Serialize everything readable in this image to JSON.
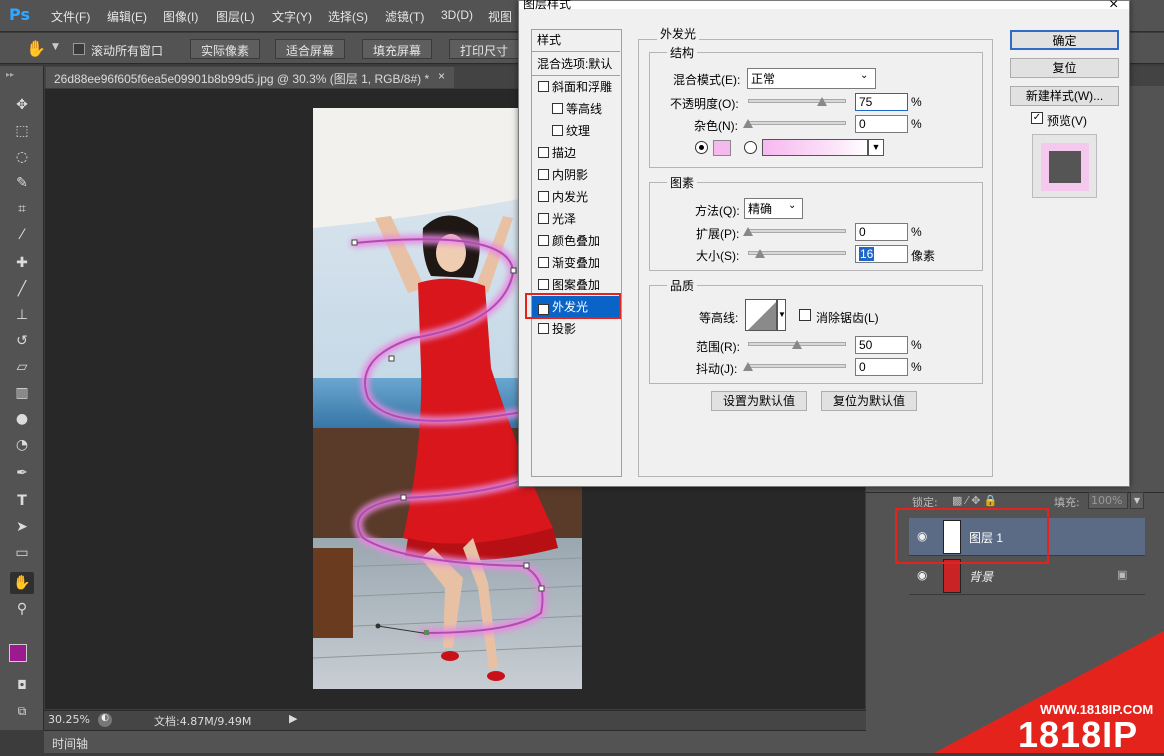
{
  "app": {
    "logo": "Ps",
    "menu": [
      "文件(F)",
      "编辑(E)",
      "图像(I)",
      "图层(L)",
      "文字(Y)",
      "选择(S)",
      "滤镜(T)",
      "3D(D)",
      "视图"
    ]
  },
  "options_bar": {
    "scroll_all_label": "滚动所有窗口",
    "buttons": [
      "实际像素",
      "适合屏幕",
      "填充屏幕",
      "打印尺寸"
    ]
  },
  "document": {
    "tab_title": "26d88ee96f605f6ea5e09901b8b99d5.jpg @ 30.3% (图层 1, RGB/8#) *",
    "close_glyph": "×"
  },
  "status": {
    "zoom": "30.25%",
    "doc_size": "文档:4.87M/9.49M",
    "timeline": "时间轴"
  },
  "layers": {
    "lock_label": "锁定:",
    "fill_label": "填充:",
    "fill_value": "100%",
    "items": [
      {
        "name": "图层 1",
        "selected": true
      },
      {
        "name": "背景",
        "selected": false
      }
    ]
  },
  "dialog": {
    "title": "图层样式",
    "close_glyph": "×",
    "styles_header": "样式",
    "blend_options": "混合选项:默认",
    "style_items": [
      {
        "label": "斜面和浮雕",
        "checked": false,
        "indent": false
      },
      {
        "label": "等高线",
        "checked": false,
        "indent": true
      },
      {
        "label": "纹理",
        "checked": false,
        "indent": true
      },
      {
        "label": "描边",
        "checked": false,
        "indent": false
      },
      {
        "label": "内阴影",
        "checked": false,
        "indent": false
      },
      {
        "label": "内发光",
        "checked": false,
        "indent": false
      },
      {
        "label": "光泽",
        "checked": false,
        "indent": false
      },
      {
        "label": "颜色叠加",
        "checked": false,
        "indent": false
      },
      {
        "label": "渐变叠加",
        "checked": false,
        "indent": false
      },
      {
        "label": "图案叠加",
        "checked": false,
        "indent": false
      },
      {
        "label": "外发光",
        "checked": true,
        "indent": false,
        "selected": true
      },
      {
        "label": "投影",
        "checked": false,
        "indent": false
      }
    ],
    "panel_title": "外发光",
    "structure": {
      "title": "结构",
      "blend_mode_label": "混合模式(E):",
      "blend_mode_value": "正常",
      "opacity_label": "不透明度(O):",
      "opacity_value": "75",
      "noise_label": "杂色(N):",
      "noise_value": "0",
      "percent": "%",
      "glow_color": "#f7b8f0"
    },
    "elements": {
      "title": "图素",
      "method_label": "方法(Q):",
      "method_value": "精确",
      "spread_label": "扩展(P):",
      "spread_value": "0",
      "size_label": "大小(S):",
      "size_value": "16",
      "size_unit": "像素"
    },
    "quality": {
      "title": "品质",
      "contour_label": "等高线:",
      "antialias_label": "消除锯齿(L)",
      "range_label": "范围(R):",
      "range_value": "50",
      "jitter_label": "抖动(J):",
      "jitter_value": "0"
    },
    "set_default": "设置为默认值",
    "reset_default": "复位为默认值",
    "ok": "确定",
    "reset": "复位",
    "new_style": "新建样式(W)...",
    "preview_label": "预览(V)"
  },
  "watermark": {
    "url": "WWW.1818IP.COM",
    "brand": "1818IP"
  },
  "colors": {
    "foreground": "#9b1a8e",
    "background": "#ffffff",
    "highlight": "#e4241c",
    "selection": "#0a64c8"
  }
}
